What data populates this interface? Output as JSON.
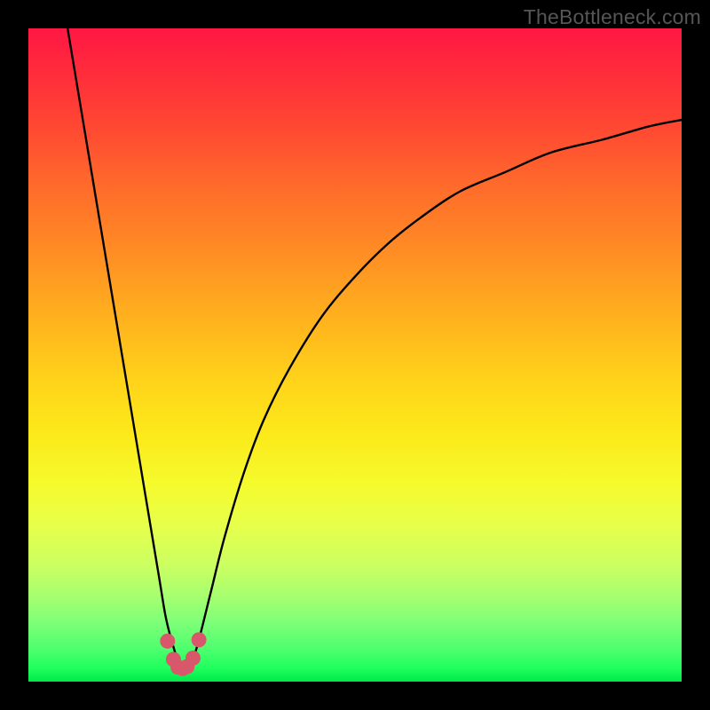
{
  "watermark": "TheBottleneck.com",
  "chart_data": {
    "type": "line",
    "title": "",
    "xlabel": "",
    "ylabel": "",
    "xlim": [
      0,
      100
    ],
    "ylim": [
      0,
      100
    ],
    "series": [
      {
        "name": "bottleneck-curve",
        "x": [
          6,
          8,
          10,
          12,
          14,
          16,
          18,
          20,
          21,
          22,
          23,
          24,
          25,
          26,
          28,
          30,
          33,
          36,
          40,
          45,
          50,
          55,
          60,
          66,
          73,
          80,
          88,
          95,
          100
        ],
        "y": [
          100,
          88,
          76,
          64,
          52,
          40,
          28,
          16,
          10,
          6,
          3,
          2,
          3,
          6,
          14,
          22,
          32,
          40,
          48,
          56,
          62,
          67,
          71,
          75,
          78,
          81,
          83,
          85,
          86
        ]
      }
    ],
    "dip_markers": {
      "name": "dip-highlight",
      "color": "#d9576b",
      "points_x": [
        21.3,
        22.2,
        22.9,
        23.6,
        24.3,
        25.2,
        26.1
      ],
      "points_y": [
        6.2,
        3.4,
        2.2,
        2.0,
        2.3,
        3.6,
        6.4
      ]
    }
  }
}
